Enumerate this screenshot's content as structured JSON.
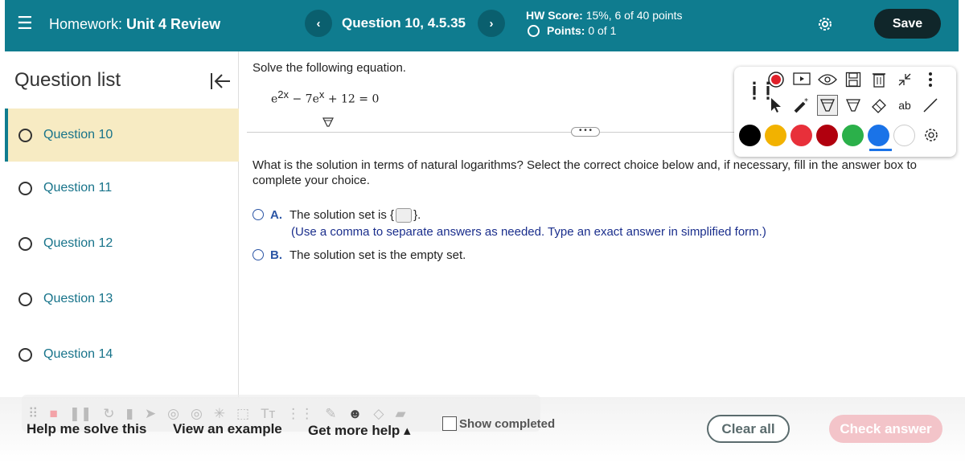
{
  "header": {
    "hw_prefix": "Homework:",
    "hw_name": "Unit 4 Review",
    "question_title": "Question 10, 4.5.35",
    "hw_score_label": "HW Score:",
    "hw_score_value": "15%, 6 of 40 points",
    "points_label": "Points:",
    "points_value": "0 of 1",
    "save_label": "Save"
  },
  "sidebar": {
    "title": "Question list",
    "items": [
      {
        "label": "Question 10",
        "active": true
      },
      {
        "label": "Question 11",
        "active": false
      },
      {
        "label": "Question 12",
        "active": false
      },
      {
        "label": "Question 13",
        "active": false
      },
      {
        "label": "Question 14",
        "active": false
      }
    ]
  },
  "main": {
    "prompt": "Solve the following equation.",
    "equation": {
      "b1": "e",
      "e1": "2x",
      "m1": " − 7",
      "b2": "e",
      "e2": "x",
      "tail": " + 12 = 0"
    },
    "question": "What is the solution in terms of natural logarithms? Select the correct choice below and, if necessary, fill in the answer box to complete your choice.",
    "choice_a": {
      "letter": "A.",
      "pre": "The solution set is {",
      "post": "}."
    },
    "hint": "(Use a comma to separate answers as needed. Type an exact answer in simplified form.)",
    "choice_b": {
      "letter": "B.",
      "text": "The solution set is the empty set."
    }
  },
  "annotation_toolbar": {
    "colors": [
      "#000000",
      "#f2b200",
      "#e8303a",
      "#b1000e",
      "#2bb04a",
      "#1a73e8",
      "#ffffff"
    ],
    "selected_color": "#1a73e8",
    "ab_label": "ab"
  },
  "bottom": {
    "help_me_solve": "Help me solve this",
    "view_example": "View an example",
    "get_more_help": "Get more help ▴",
    "show_completed": "Show completed",
    "clear_all": "Clear all",
    "check_answer": "Check answer"
  }
}
